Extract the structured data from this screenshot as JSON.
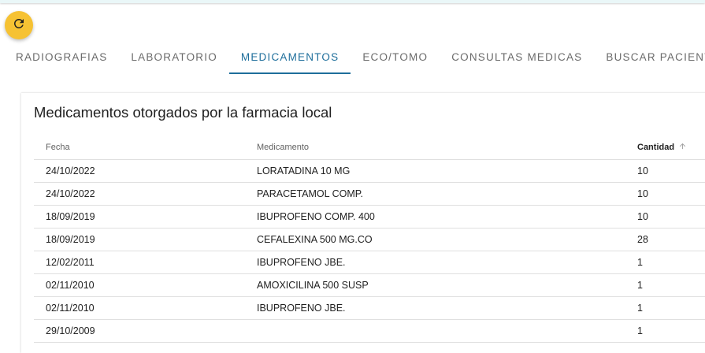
{
  "icons": {
    "refresh": "refresh-icon",
    "sort": "arrow-up-icon"
  },
  "colors": {
    "accent": "#1e6e9b",
    "refresh_button": "#f6c233"
  },
  "tabs": [
    {
      "label": "RADIOGRAFIAS",
      "active": false
    },
    {
      "label": "LABORATORIO",
      "active": false
    },
    {
      "label": "MEDICAMENTOS",
      "active": true
    },
    {
      "label": "ECO/TOMO",
      "active": false
    },
    {
      "label": "CONSULTAS MEDICAS",
      "active": false
    },
    {
      "label": "BUSCAR PACIENTE",
      "active": false
    }
  ],
  "panel": {
    "title": "Medicamentos otorgados por la farmacia local",
    "columns": {
      "fecha": "Fecha",
      "medicamento": "Medicamento",
      "cantidad": "Cantidad"
    },
    "rows": [
      {
        "fecha": "24/10/2022",
        "medicamento": "LORATADINA 10 MG",
        "cantidad": "10"
      },
      {
        "fecha": "24/10/2022",
        "medicamento": "PARACETAMOL COMP.",
        "cantidad": "10"
      },
      {
        "fecha": "18/09/2019",
        "medicamento": "IBUPROFENO COMP. 400",
        "cantidad": "10"
      },
      {
        "fecha": "18/09/2019",
        "medicamento": "CEFALEXINA 500 MG.CO",
        "cantidad": "28"
      },
      {
        "fecha": "12/02/2011",
        "medicamento": "IBUPROFENO JBE.",
        "cantidad": "1"
      },
      {
        "fecha": "02/11/2010",
        "medicamento": "AMOXICILINA 500 SUSP",
        "cantidad": "1"
      },
      {
        "fecha": "02/11/2010",
        "medicamento": "IBUPROFENO JBE.",
        "cantidad": "1"
      },
      {
        "fecha": "29/10/2009",
        "medicamento": "",
        "cantidad": "1"
      }
    ]
  }
}
